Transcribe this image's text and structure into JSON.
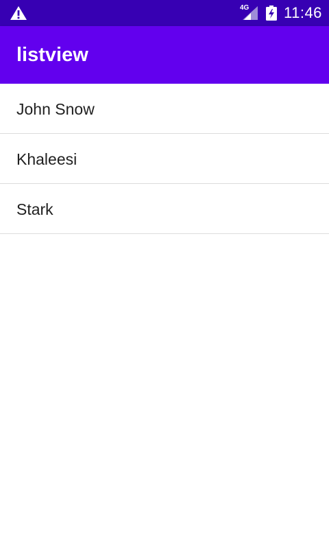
{
  "status_bar": {
    "network": "4G",
    "time": "11:46",
    "icons": [
      "warning-icon",
      "signal-icon",
      "battery-charging-icon"
    ],
    "background": "#3700b3"
  },
  "app_bar": {
    "title": "listview",
    "background": "#6200ee"
  },
  "list": {
    "items": [
      {
        "label": "John Snow"
      },
      {
        "label": "Khaleesi"
      },
      {
        "label": "Stark"
      }
    ]
  }
}
